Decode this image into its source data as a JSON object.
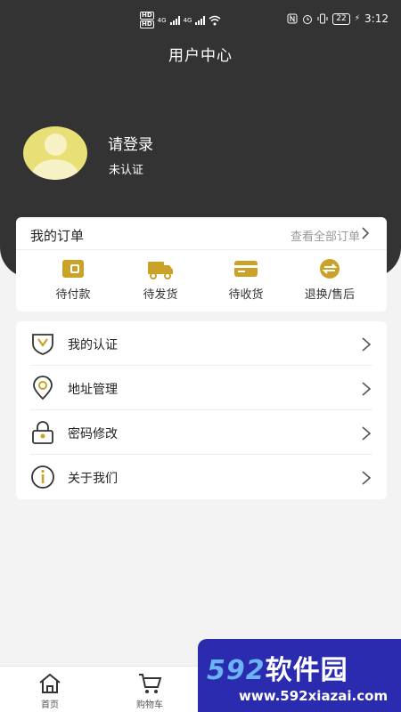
{
  "status_bar": {
    "left_badges": [
      "HD",
      "HD"
    ],
    "network": [
      "4G",
      "4G"
    ],
    "battery": "22",
    "time": "3:12"
  },
  "header": {
    "title": "用户中心"
  },
  "profile": {
    "name": "请登录",
    "status": "未认证",
    "avatar_color": "#e8e077"
  },
  "orders": {
    "title": "我的订单",
    "view_all": "查看全部订单",
    "items": [
      {
        "label": "待付款",
        "icon": "wallet-icon"
      },
      {
        "label": "待发货",
        "icon": "truck-icon"
      },
      {
        "label": "待收货",
        "icon": "card-icon"
      },
      {
        "label": "退换/售后",
        "icon": "exchange-icon"
      }
    ]
  },
  "menu": {
    "items": [
      {
        "label": "我的认证",
        "icon": "shield-icon"
      },
      {
        "label": "地址管理",
        "icon": "location-icon"
      },
      {
        "label": "密码修改",
        "icon": "lock-icon"
      },
      {
        "label": "关于我们",
        "icon": "info-icon"
      }
    ]
  },
  "tabbar": {
    "items": [
      {
        "label": "首页",
        "icon": "home-icon"
      },
      {
        "label": "购物车",
        "icon": "cart-icon"
      }
    ]
  },
  "watermark": {
    "brand_number": "592",
    "brand_text": "软件园",
    "url": "www.592xiazai.com"
  },
  "colors": {
    "hero_bg": "#343334",
    "accent_gold": "#c9a227",
    "page_bg": "#f3f3f3"
  }
}
